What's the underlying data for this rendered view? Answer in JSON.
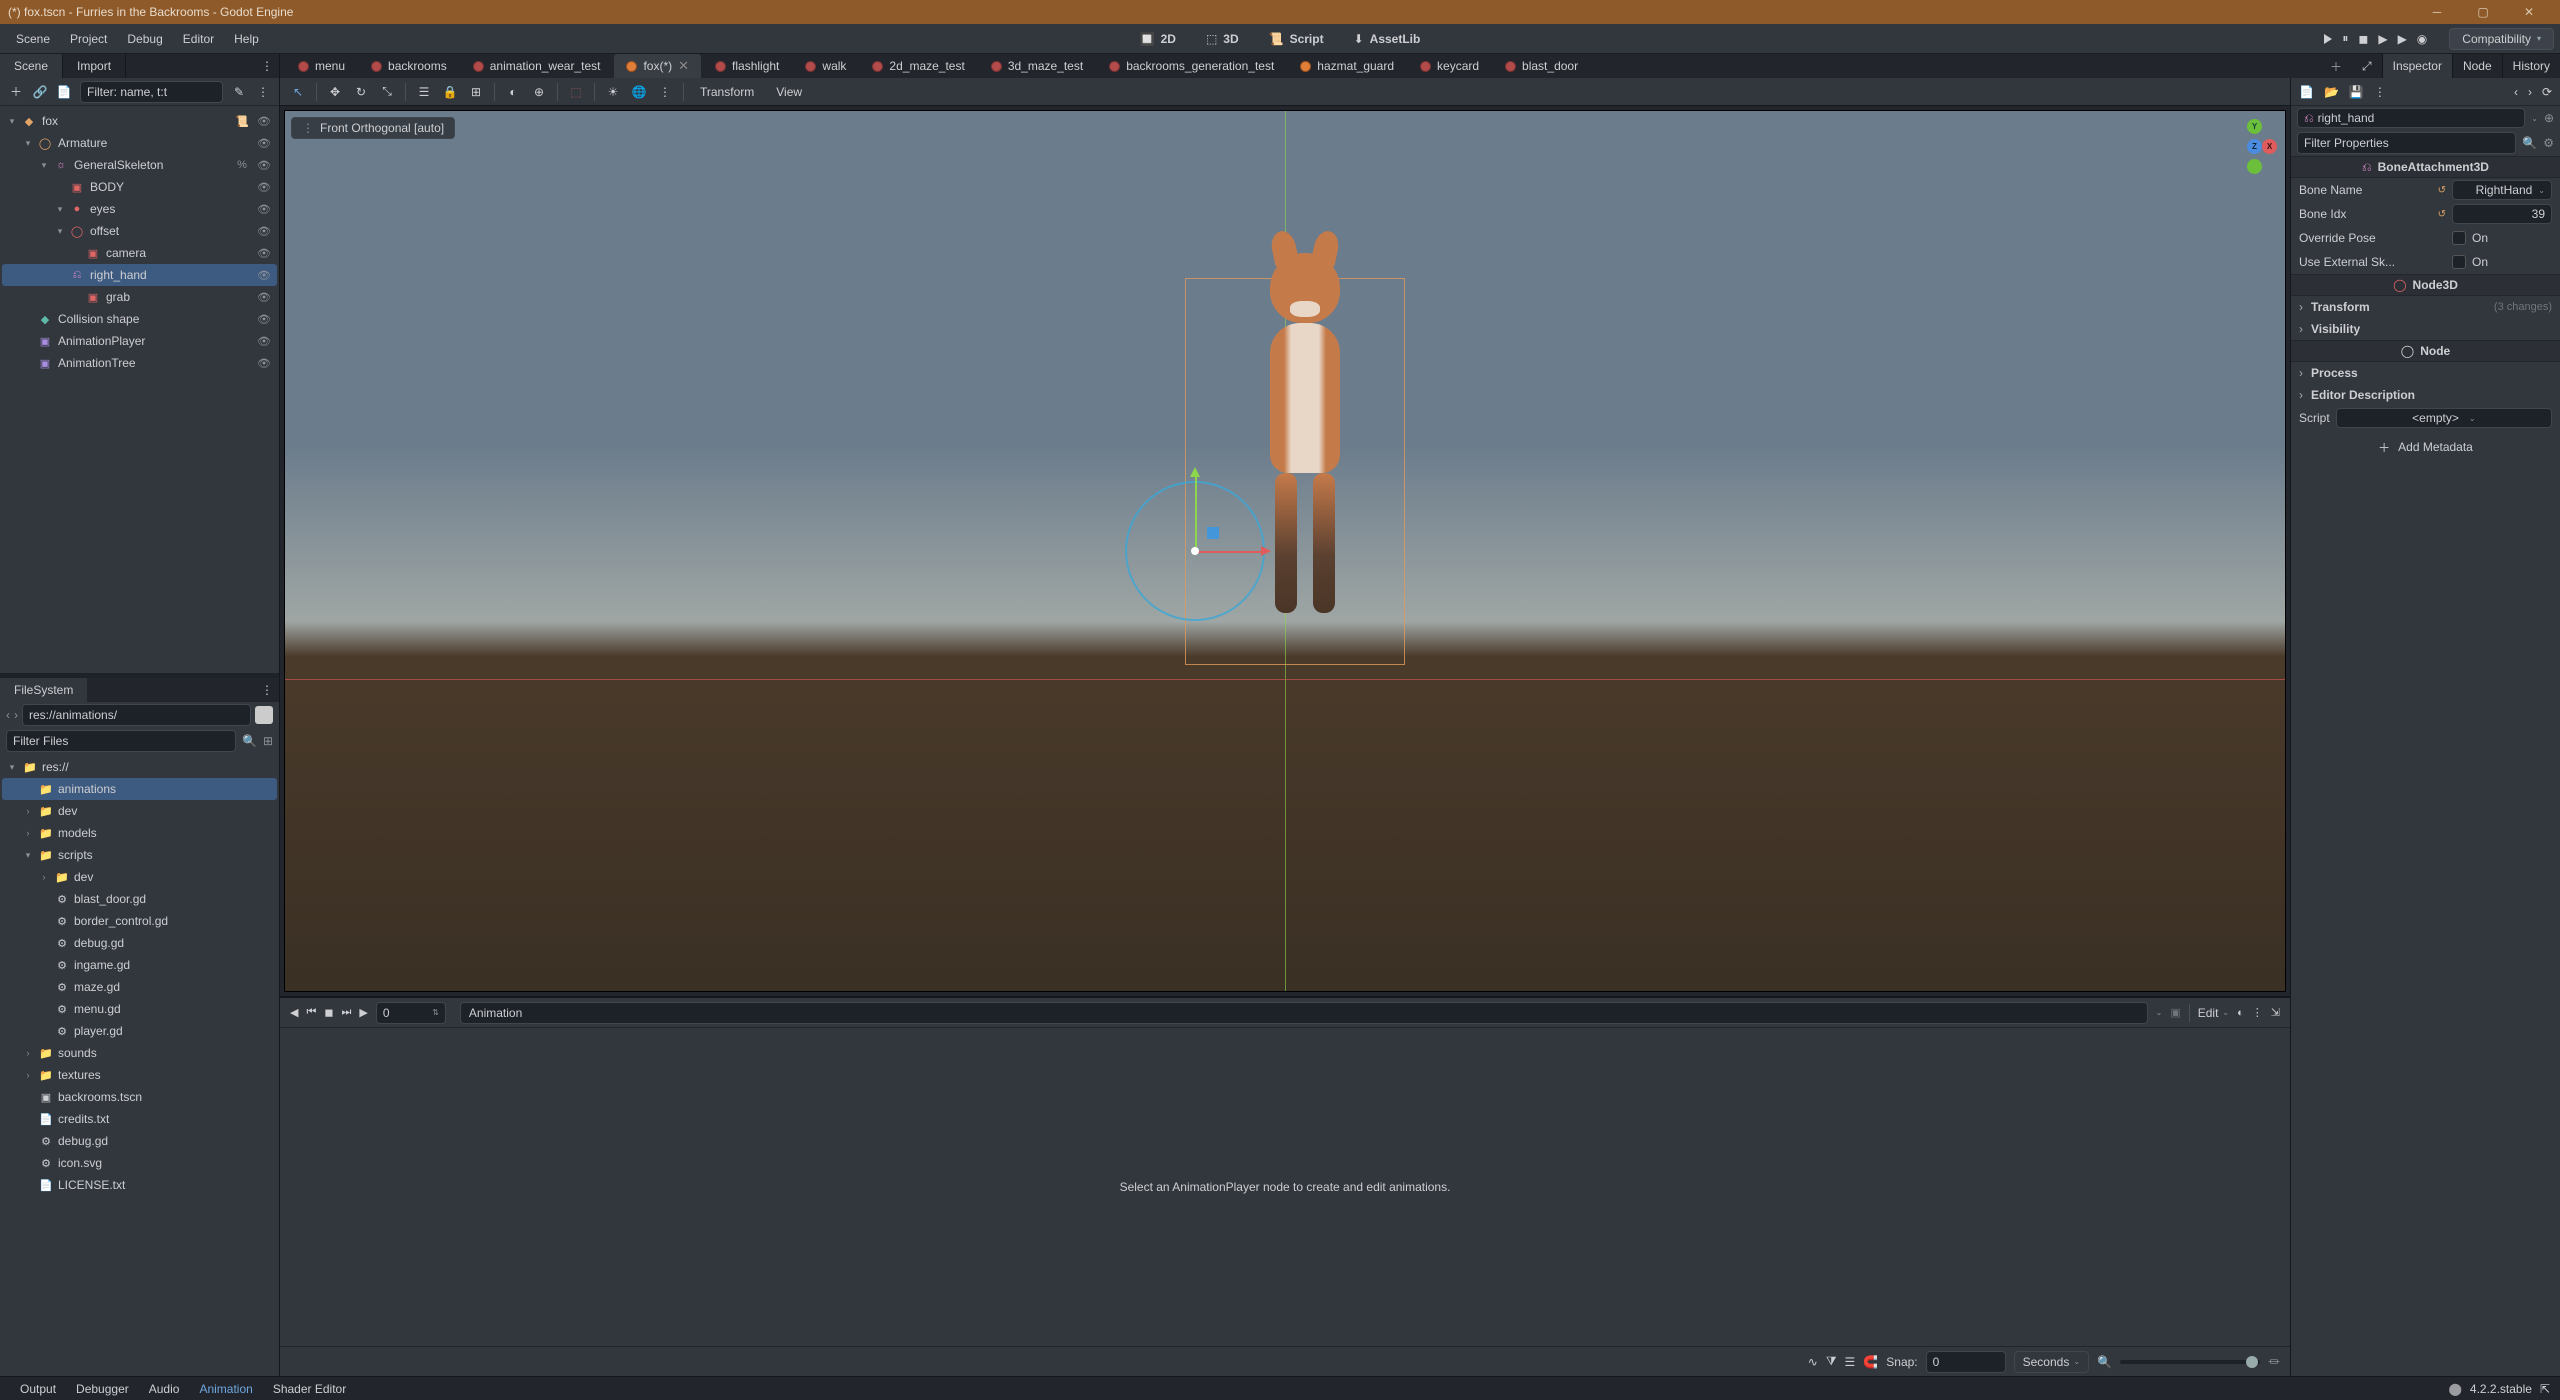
{
  "title": "(*) fox.tscn - Furries in the Backrooms - Godot Engine",
  "menus": [
    "Scene",
    "Project",
    "Debug",
    "Editor",
    "Help"
  ],
  "workspaces": [
    {
      "label": "2D",
      "active": false,
      "icon": "🔲"
    },
    {
      "label": "3D",
      "active": true,
      "icon": "⬚"
    },
    {
      "label": "Script",
      "active": false,
      "icon": "📜"
    },
    {
      "label": "AssetLib",
      "active": false,
      "icon": "⬇"
    }
  ],
  "renderer": "Compatibility",
  "leftTabs": {
    "scene": "Scene",
    "import": "Import"
  },
  "rightTabs": {
    "inspector": "Inspector",
    "node": "Node",
    "history": "History"
  },
  "scene_filter_placeholder": "Filter: name, t:t",
  "scenes": [
    {
      "label": "menu",
      "active": false,
      "icon": "dot"
    },
    {
      "label": "backrooms",
      "active": false,
      "icon": "dot"
    },
    {
      "label": "animation_wear_test",
      "active": false,
      "icon": "dot"
    },
    {
      "label": "fox(*)",
      "active": true,
      "icon": "dot2"
    },
    {
      "label": "flashlight",
      "active": false,
      "icon": "dot"
    },
    {
      "label": "walk",
      "active": false,
      "icon": "dot"
    },
    {
      "label": "2d_maze_test",
      "active": false,
      "icon": "dot"
    },
    {
      "label": "3d_maze_test",
      "active": false,
      "icon": "dot"
    },
    {
      "label": "backrooms_generation_test",
      "active": false,
      "icon": "dot"
    },
    {
      "label": "hazmat_guard",
      "active": false,
      "icon": "dot2"
    },
    {
      "label": "keycard",
      "active": false,
      "icon": "dot"
    },
    {
      "label": "blast_door",
      "active": false,
      "icon": "dot"
    }
  ],
  "tree": [
    {
      "d": 0,
      "tw": "▾",
      "ic": "ic-orange",
      "g": "◆",
      "l": "fox",
      "extra": "script"
    },
    {
      "d": 1,
      "tw": "▾",
      "ic": "ic-orange",
      "g": "◯",
      "l": "Armature"
    },
    {
      "d": 2,
      "tw": "▾",
      "ic": "ic-pink",
      "g": "☼",
      "l": "GeneralSkeleton",
      "extra": "pct"
    },
    {
      "d": 3,
      "tw": "",
      "ic": "ic-red",
      "g": "▣",
      "l": "BODY"
    },
    {
      "d": 3,
      "tw": "▾",
      "ic": "ic-red",
      "g": "●",
      "l": "eyes"
    },
    {
      "d": 3,
      "tw": "▾",
      "ic": "ic-red",
      "g": "◯",
      "l": "offset"
    },
    {
      "d": 4,
      "tw": "",
      "ic": "ic-red",
      "g": "▣",
      "l": "camera"
    },
    {
      "d": 3,
      "tw": "",
      "ic": "ic-pink",
      "g": "⎌",
      "l": "right_hand",
      "sel": true
    },
    {
      "d": 4,
      "tw": "",
      "ic": "ic-red",
      "g": "▣",
      "l": "grab"
    },
    {
      "d": 1,
      "tw": "",
      "ic": "ic-teal",
      "g": "◆",
      "l": "Collision shape"
    },
    {
      "d": 1,
      "tw": "",
      "ic": "ic-purple",
      "g": "▣",
      "l": "AnimationPlayer"
    },
    {
      "d": 1,
      "tw": "",
      "ic": "ic-purple",
      "g": "▣",
      "l": "AnimationTree"
    }
  ],
  "fs_tab": "FileSystem",
  "fs_path": "res://animations/",
  "fs_filter_placeholder": "Filter Files",
  "fs": [
    {
      "d": 0,
      "tw": "▾",
      "t": "folder",
      "l": "res://"
    },
    {
      "d": 1,
      "tw": "",
      "t": "folder",
      "l": "animations",
      "sel": true
    },
    {
      "d": 1,
      "tw": "›",
      "t": "folder",
      "l": "dev"
    },
    {
      "d": 1,
      "tw": "›",
      "t": "folder",
      "l": "models"
    },
    {
      "d": 1,
      "tw": "▾",
      "t": "folder",
      "l": "scripts"
    },
    {
      "d": 2,
      "tw": "›",
      "t": "folder",
      "l": "dev"
    },
    {
      "d": 2,
      "tw": "",
      "t": "gd",
      "l": "blast_door.gd"
    },
    {
      "d": 2,
      "tw": "",
      "t": "gd",
      "l": "border_control.gd"
    },
    {
      "d": 2,
      "tw": "",
      "t": "gd",
      "l": "debug.gd"
    },
    {
      "d": 2,
      "tw": "",
      "t": "gd",
      "l": "ingame.gd"
    },
    {
      "d": 2,
      "tw": "",
      "t": "gd",
      "l": "maze.gd"
    },
    {
      "d": 2,
      "tw": "",
      "t": "gd",
      "l": "menu.gd"
    },
    {
      "d": 2,
      "tw": "",
      "t": "gd",
      "l": "player.gd"
    },
    {
      "d": 1,
      "tw": "›",
      "t": "folder",
      "l": "sounds"
    },
    {
      "d": 1,
      "tw": "›",
      "t": "folder",
      "l": "textures"
    },
    {
      "d": 1,
      "tw": "",
      "t": "scn",
      "l": "backrooms.tscn"
    },
    {
      "d": 1,
      "tw": "",
      "t": "txt",
      "l": "credits.txt"
    },
    {
      "d": 1,
      "tw": "",
      "t": "gd",
      "l": "debug.gd"
    },
    {
      "d": 1,
      "tw": "",
      "t": "svg",
      "l": "icon.svg"
    },
    {
      "d": 1,
      "tw": "",
      "t": "txt",
      "l": "LICENSE.txt"
    }
  ],
  "vp_badge": "Front Orthogonal [auto]",
  "vp_menus": {
    "transform": "Transform",
    "view": "View"
  },
  "anim": {
    "frame": "0",
    "placeholder": "Animation",
    "hint": "Select an AnimationPlayer node to create and edit animations.",
    "snap_label": "Snap:",
    "snap_val": "0",
    "seconds": "Seconds",
    "edit": "Edit"
  },
  "insp": {
    "node": "right_hand",
    "filter_placeholder": "Filter Properties",
    "class1": "BoneAttachment3D",
    "props": [
      {
        "k": "Bone Name",
        "v": "RightHand",
        "reset": true,
        "drop": true
      },
      {
        "k": "Bone Idx",
        "v": "39",
        "reset": true,
        "num": true
      },
      {
        "k": "Override Pose",
        "v": "On",
        "check": true
      },
      {
        "k": "Use External Sk...",
        "v": "On",
        "check": true
      }
    ],
    "class2": "Node3D",
    "cats": [
      {
        "l": "Transform",
        "c": "(3 changes)"
      },
      {
        "l": "Visibility",
        "c": ""
      }
    ],
    "class3": "Node",
    "cats2": [
      {
        "l": "Process",
        "c": ""
      },
      {
        "l": "Editor Description",
        "c": ""
      }
    ],
    "script_k": "Script",
    "script_v": "<empty>",
    "addmeta": "Add Metadata"
  },
  "bottom": [
    "Output",
    "Debugger",
    "Audio",
    "Animation",
    "Shader Editor"
  ],
  "version": "4.2.2.stable"
}
